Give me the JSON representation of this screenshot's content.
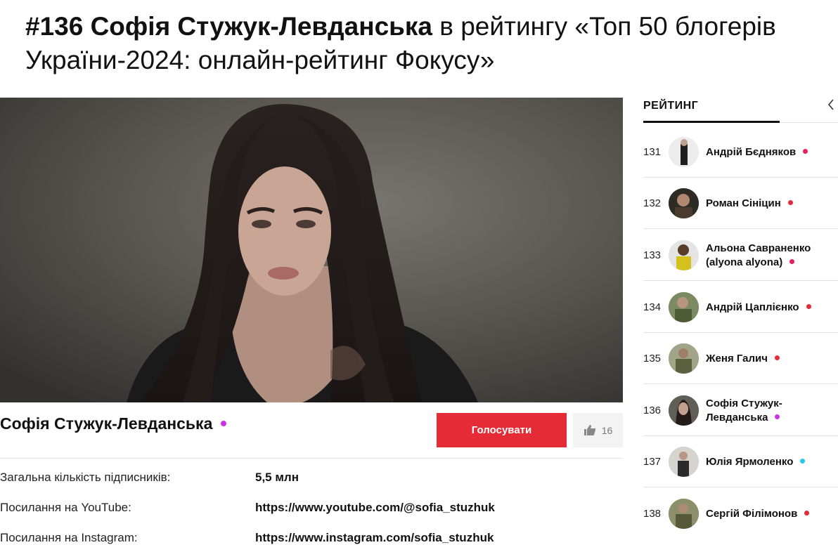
{
  "page": {
    "title_bold": "#136 Софія Стужук-Левданська",
    "title_rest": " в рейтингу «Топ 50 блогерів України-2024: онлайн-рейтинг Фокусу»"
  },
  "profile": {
    "name": "Софія Стужук-Левданська",
    "dot_color": "#c832e6",
    "vote_label": "Голосувати",
    "likes": "16",
    "like_icon": "thumbs-up-icon"
  },
  "info": [
    {
      "label": "Загальна кількість підписників:",
      "value": "5,5 млн"
    },
    {
      "label": "Посилання на YouTube:",
      "value": "https://www.youtube.com/@sofia_stuzhuk"
    },
    {
      "label": "Посилання на Instagram:",
      "value": "https://www.instagram.com/sofia_stuzhuk"
    }
  ],
  "rating": {
    "header": "РЕЙТИНГ",
    "chevron_icon": "chevron-left-icon",
    "items": [
      {
        "num": "131",
        "name": "Андрій Бєдняков",
        "dot": "#e8205a"
      },
      {
        "num": "132",
        "name": "Роман Сініцин",
        "dot": "#e52b35"
      },
      {
        "num": "133",
        "name": "Альона Савраненко (alyona alyona)",
        "dot": "#e8205a"
      },
      {
        "num": "134",
        "name": "Андрій Цаплієнко",
        "dot": "#e52b35"
      },
      {
        "num": "135",
        "name": "Женя Галич",
        "dot": "#e52b35"
      },
      {
        "num": "136",
        "name": "Софія Стужук-Левданська",
        "dot": "#c832e6"
      },
      {
        "num": "137",
        "name": "Юлія Ярмоленко",
        "dot": "#2bc8e6"
      },
      {
        "num": "138",
        "name": "Сергій Філімонов",
        "dot": "#e52b35"
      }
    ]
  }
}
